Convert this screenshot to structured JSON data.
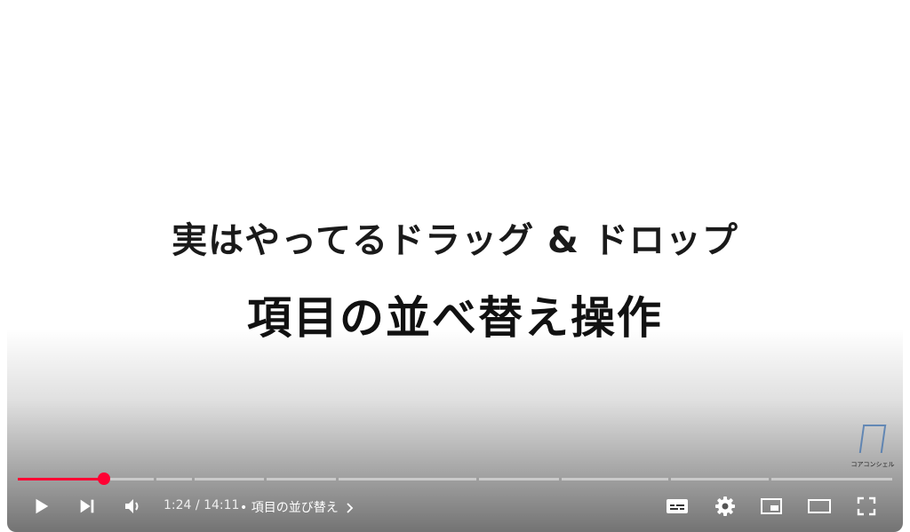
{
  "slide": {
    "title": "実はやってるドラッグ & ドロップ",
    "subtitle": "項目の並べ替え操作"
  },
  "watermark": {
    "text": "コアコンシェル"
  },
  "player": {
    "current_time": "1:24",
    "separator": " / ",
    "duration": "14:11",
    "chapter_prefix": "•",
    "chapter_title": "項目の並び替え",
    "progress_fraction": 0.099,
    "accent_color": "#ff0033"
  },
  "controls": {
    "play_icon": "play-icon",
    "next_icon": "next-icon",
    "volume_icon": "volume-icon",
    "subtitles_icon": "subtitles-icon",
    "settings_icon": "gear-icon",
    "miniplayer_icon": "miniplayer-icon",
    "theater_icon": "theater-icon",
    "fullscreen_icon": "fullscreen-icon"
  }
}
